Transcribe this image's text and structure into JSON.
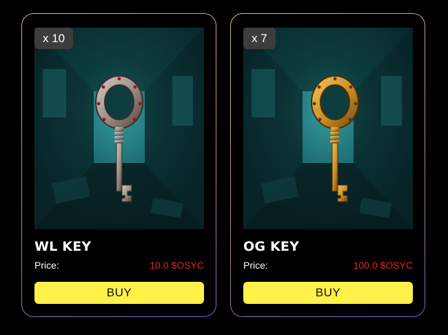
{
  "cards": [
    {
      "quantity": "x 10",
      "title": "WL KEY",
      "price_label": "Price:",
      "price_value": "10.0 $OSYC",
      "buy_label": "BUY",
      "key_finish": "silver",
      "key_colors": {
        "light": "#d6cdc8",
        "mid": "#9a8a84",
        "dark": "#4d3f3a"
      }
    },
    {
      "quantity": "x 7",
      "title": "OG KEY",
      "price_label": "Price:",
      "price_value": "100.0 $OSYC",
      "buy_label": "BUY",
      "key_finish": "gold",
      "key_colors": {
        "light": "#f6c75a",
        "mid": "#c98b25",
        "dark": "#6b4612"
      }
    }
  ],
  "colors": {
    "background": "#000000",
    "badge_bg": "#3d3d3d",
    "price_value": "#e0262b",
    "buy_button": "#fff04a",
    "scene_teal": "#2a8a8f"
  }
}
